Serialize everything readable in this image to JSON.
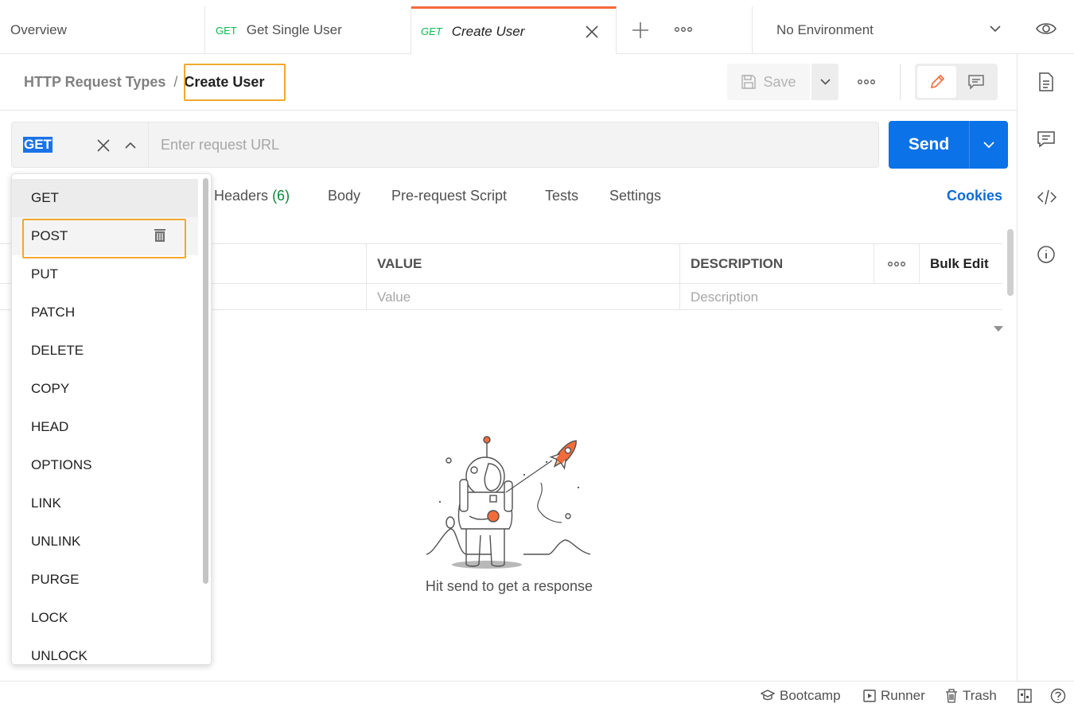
{
  "tabs": [
    {
      "label": "Overview"
    },
    {
      "method": "GET",
      "label": "Get Single User"
    },
    {
      "method": "GET",
      "label": "Create User",
      "active": true
    }
  ],
  "environment": {
    "selected": "No Environment"
  },
  "breadcrumb": {
    "parent": "HTTP Request Types",
    "separator": "/",
    "current": "Create User"
  },
  "toolbar": {
    "save_label": "Save"
  },
  "request": {
    "method": "GET",
    "url_placeholder": "Enter request URL",
    "send_label": "Send"
  },
  "request_tabs": [
    {
      "label": "Headers",
      "count": "(6)"
    },
    {
      "label": "Body"
    },
    {
      "label": "Pre-request Script"
    },
    {
      "label": "Tests"
    },
    {
      "label": "Settings"
    }
  ],
  "cookies_label": "Cookies",
  "params_table": {
    "headers": {
      "value": "VALUE",
      "description": "DESCRIPTION",
      "bulk_edit": "Bulk Edit"
    },
    "row_placeholders": {
      "value": "Value",
      "description": "Description"
    }
  },
  "response": {
    "empty_message": "Hit send to get a response"
  },
  "methods": [
    "GET",
    "POST",
    "PUT",
    "PATCH",
    "DELETE",
    "COPY",
    "HEAD",
    "OPTIONS",
    "LINK",
    "UNLINK",
    "PURGE",
    "LOCK",
    "UNLOCK"
  ],
  "footer": {
    "bootcamp": "Bootcamp",
    "runner": "Runner",
    "trash": "Trash"
  },
  "colors": {
    "accent": "#f26b3a",
    "send": "#0b72e7",
    "get": "#0cbb52",
    "highlight": "#f0a830",
    "link": "#0b6bd8"
  }
}
